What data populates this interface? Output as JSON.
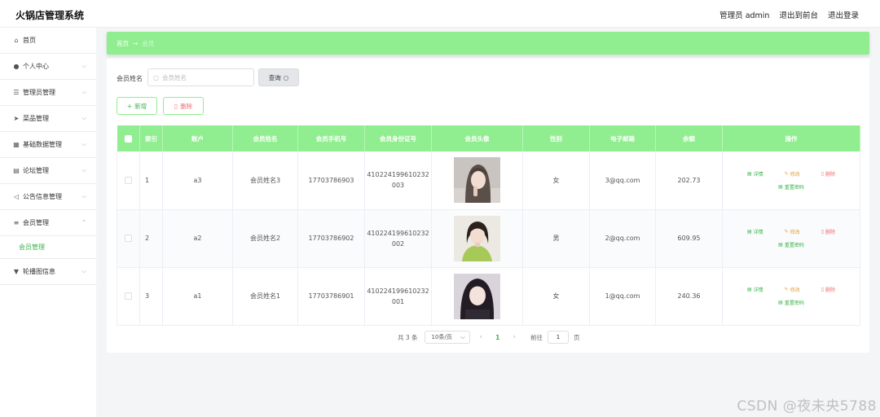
{
  "app": {
    "title": "火锅店管理系统"
  },
  "header": {
    "admin_label": "管理员 admin",
    "to_front": "退出到前台",
    "logout": "退出登录"
  },
  "sidebar": {
    "items": [
      {
        "label": "首页",
        "icon": "home-icon"
      },
      {
        "label": "个人中心",
        "icon": "user-icon"
      },
      {
        "label": "管理员管理",
        "icon": "sliders-icon"
      },
      {
        "label": "菜品管理",
        "icon": "send-icon"
      },
      {
        "label": "基础数据管理",
        "icon": "chart-icon"
      },
      {
        "label": "论坛管理",
        "icon": "forum-icon"
      },
      {
        "label": "公告信息管理",
        "icon": "announce-icon"
      },
      {
        "label": "会员管理",
        "icon": "list-icon"
      },
      {
        "label": "轮播图信息",
        "icon": "carousel-icon"
      }
    ],
    "sub_active": "会员管理"
  },
  "breadcrumb": {
    "home": "首页",
    "current": "会员"
  },
  "search": {
    "label": "会员姓名",
    "placeholder": "会员姓名",
    "query_button": "查询"
  },
  "actions": {
    "add": "新增",
    "delete": "删除"
  },
  "table": {
    "headers": [
      "",
      "索引",
      "账户",
      "会员姓名",
      "会员手机号",
      "会员身份证号",
      "会员头像",
      "性别",
      "电子邮箱",
      "余额",
      "操作"
    ],
    "rows": [
      {
        "index": "1",
        "account": "a3",
        "name": "会员姓名3",
        "phone": "17703786903",
        "id_line1": "410224199610232",
        "id_line2": "003",
        "gender": "女",
        "email": "3@qq.com",
        "balance": "202.73"
      },
      {
        "index": "2",
        "account": "a2",
        "name": "会员姓名2",
        "phone": "17703786902",
        "id_line1": "410224199610232",
        "id_line2": "002",
        "gender": "男",
        "email": "2@qq.com",
        "balance": "609.95"
      },
      {
        "index": "3",
        "account": "a1",
        "name": "会员姓名1",
        "phone": "17703786901",
        "id_line1": "410224199610232",
        "id_line2": "001",
        "gender": "女",
        "email": "1@qq.com",
        "balance": "240.36"
      }
    ],
    "ops": {
      "detail": "详情",
      "edit": "修改",
      "delete": "删除",
      "reset": "重置密码"
    }
  },
  "pagination": {
    "total": "共 3 条",
    "page_size": "10条/页",
    "current": "1",
    "goto_label": "前往",
    "goto_value": "1",
    "page_unit": "页"
  },
  "watermark": "CSDN @夜未央5788",
  "colors": {
    "accent": "#90ee90",
    "accent_text": "#3ab54a",
    "danger": "#f56c6c",
    "warning": "#e6a23c"
  }
}
